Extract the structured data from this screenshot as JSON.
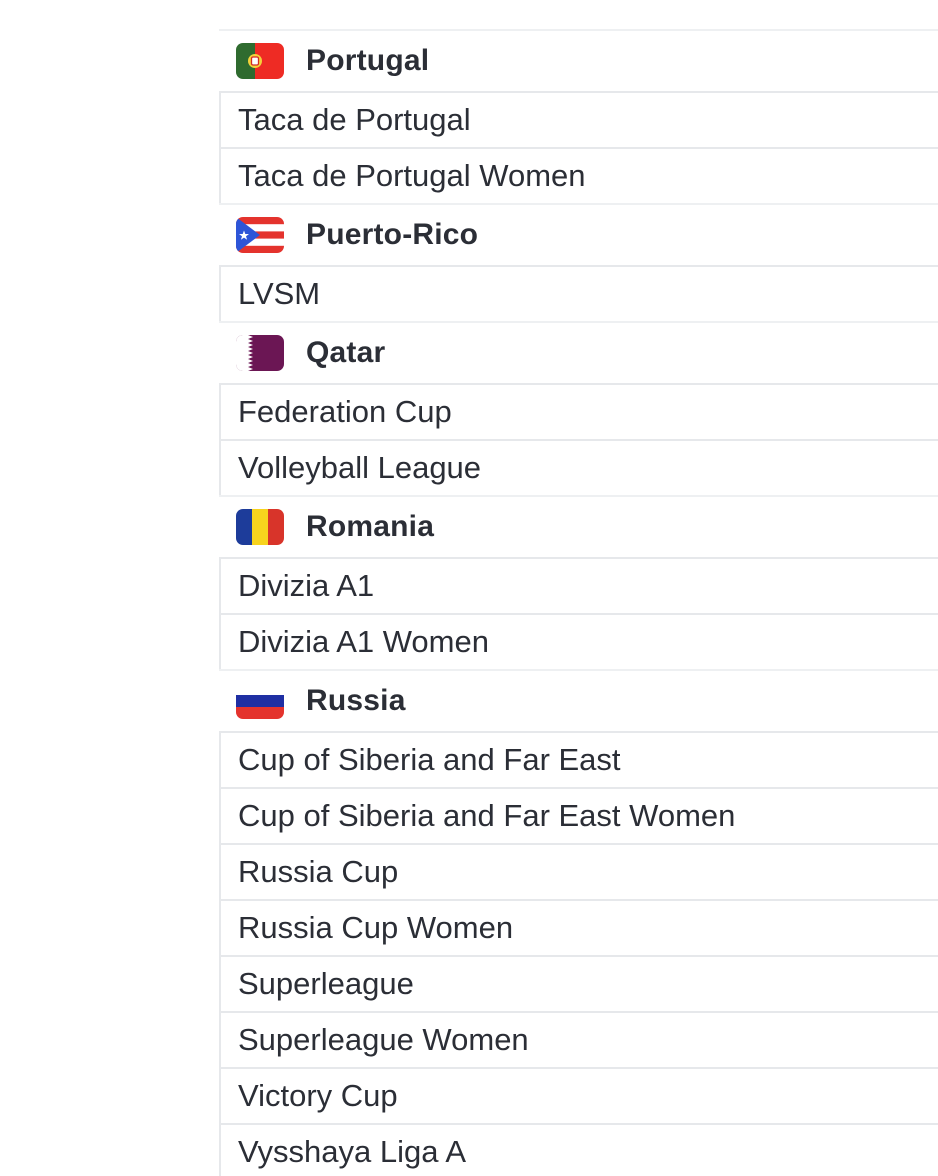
{
  "groups": [
    {
      "country": "Portugal",
      "flag_icon": "flag-portugal-icon",
      "leagues": [
        "Taca de Portugal",
        "Taca de Portugal Women"
      ]
    },
    {
      "country": "Puerto-Rico",
      "flag_icon": "flag-puerto-rico-icon",
      "leagues": [
        "LVSM"
      ]
    },
    {
      "country": "Qatar",
      "flag_icon": "flag-qatar-icon",
      "leagues": [
        "Federation Cup",
        "Volleyball League"
      ]
    },
    {
      "country": "Romania",
      "flag_icon": "flag-romania-icon",
      "leagues": [
        "Divizia A1",
        "Divizia A1 Women"
      ]
    },
    {
      "country": "Russia",
      "flag_icon": "flag-russia-icon",
      "leagues": [
        "Cup of Siberia and Far East",
        "Cup of Siberia and Far East Women",
        "Russia Cup",
        "Russia Cup Women",
        "Superleague",
        "Superleague Women",
        "Victory Cup",
        "Vysshaya Liga A"
      ]
    }
  ],
  "colors": {
    "text": "#2b2e36",
    "divider": "#e6e8eb",
    "portugal_green": "#2f6b2f",
    "portugal_red": "#ee2b24",
    "puerto_rico_blue": "#2d55d8",
    "puerto_rico_red": "#e4332d",
    "qatar_maroon": "#6b1654",
    "romania_blue": "#1d3c9a",
    "romania_yellow": "#f7d31e",
    "romania_red": "#d8342a",
    "russia_blue": "#1f2fa3",
    "russia_red": "#e4332d"
  }
}
